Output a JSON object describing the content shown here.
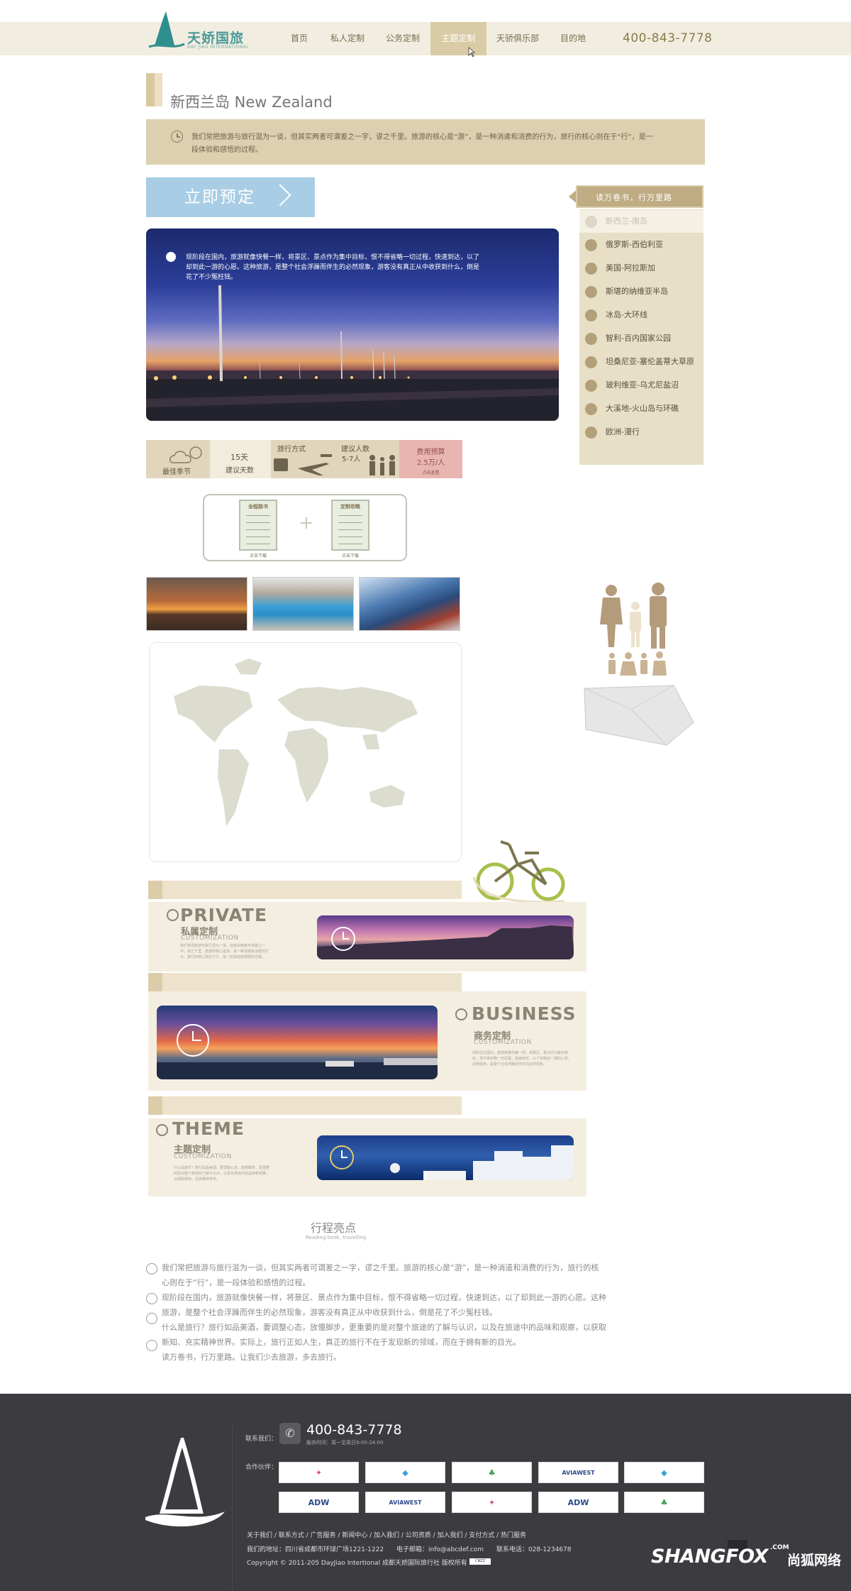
{
  "header": {
    "brand": "天娇国旅",
    "brand_sub": "DAY JIAO INTERNATIONAL",
    "nav": [
      {
        "label": "首页"
      },
      {
        "label": "私人定制"
      },
      {
        "label": "公务定制"
      },
      {
        "label": "主题定制",
        "active": true
      },
      {
        "label": "天骄俱乐部"
      },
      {
        "label": "目的地"
      }
    ],
    "phone": "400-843-7778"
  },
  "page": {
    "title": "新西兰岛 New Zealand",
    "intro": "我们常把旅游与旅行混为一谈，但其实两者可谓差之一字，谬之千里。旅游的核心是“游”，是一种消遣和消费的行为，旅行的核心则在于“行”，是一段体验和感悟的过程。",
    "book_button": "立即预定",
    "hero_text": "现阶段在国内，旅游就像快餐一样，将景区、景点作为集中目标，恨不得省略一切过程，快速到达，以了却到此一游的心愿。这种旅游，是整个社会浮躁而伴生的必然现象，游客没有真正从中收获到什么，倒是花了不少冤枉钱。"
  },
  "info_strip": {
    "season_label": "最佳季节",
    "days_value": "15天",
    "days_label": "建议天数",
    "travel_label": "旅行方式",
    "people_label": "建议人数",
    "people_value": "5-7人",
    "budget_label": "费用预算",
    "budget_value": "2.5万/人",
    "budget_note": "点击查看"
  },
  "docs": [
    {
      "title": "全程路书",
      "download": "点击下载"
    },
    {
      "title": "定制攻略",
      "download": "点击下载"
    }
  ],
  "sidebar": {
    "heading": "读万卷书，行万里路",
    "items": [
      {
        "label": "新西兰-南岛",
        "selected": true
      },
      {
        "label": "俄罗斯-西伯利亚"
      },
      {
        "label": "美国-阿拉斯加"
      },
      {
        "label": "斯堪的纳维亚半岛"
      },
      {
        "label": "冰岛-大环线"
      },
      {
        "label": "智利-百内国家公园"
      },
      {
        "label": "坦桑尼亚-塞伦盖蒂大草原"
      },
      {
        "label": "玻利维亚-乌尤尼盐沼"
      },
      {
        "label": "大溪地-火山岛与环礁"
      },
      {
        "label": "欧洲-漫行"
      }
    ]
  },
  "sections": {
    "private": {
      "head": "PRIVATE",
      "cn": "私属定制",
      "en": "CUSTOMIZATION",
      "desc": "我们常把旅游与旅行混为一谈，但其实两者可谓差之一字，谬之千里。旅游的核心是游，是一种消遣和消费的行为，旅行的核心则在于行，是一段体验和感悟的过程。"
    },
    "business": {
      "head": "BUSINESS",
      "cn": "商务定制",
      "en": "CUSTOMIZATION",
      "desc": "现阶段在国内，旅游就像快餐一样，将景区、景点作为集中目标，恨不得省略一切过程，快速到达，以了却到此一游的心愿。这种旅游，是整个社会浮躁而伴生的必然现象。"
    },
    "theme": {
      "head": "THEME",
      "cn": "主题定制",
      "en": "CUSTOMIZATION",
      "desc": "什么是旅行？旅行如品美酒，要调整心态，放慢脚步，更重要的是对整个旅途的了解与认识，以及在旅途中的品味和观察，以获取新知、充实精神世界。"
    }
  },
  "highlights": {
    "title": "行程亮点",
    "subtitle": "Reading book, travelling",
    "lines": [
      "我们常把旅游与旅行混为一谈，但其实两者可谓差之一字，谬之千里。旅游的核心是“游”，是一种消遣和消费的行为，旅行的核",
      "心则在于“行”，是一段体验和感悟的过程。",
      "现阶段在国内，旅游就像快餐一样，将景区、景点作为集中目标，恨不得省略一切过程，快速到达，以了却到此一游的心愿。这种",
      "旅游，是整个社会浮躁而伴生的必然现象，游客没有真正从中收获到什么，倒是花了不少冤枉钱。",
      "什么是旅行？旅行如品美酒，要调整心态，放慢脚步，更重要的是对整个旅途的了解与认识，以及在旅途中的品味和观察，以获取",
      "新知、充实精神世界。实际上，旅行正如人生，真正的旅行不在于发现新的领域，而在于拥有新的目光。",
      "读万卷书，行万里路。让我们少去旅游，多去旅行。"
    ]
  },
  "footer": {
    "contact_label": "联系我们：",
    "phone": "400-843-7778",
    "hours": "服务时间：周一至周日9:00-24:00",
    "partners_label": "合作伙伴：",
    "partners": [
      "",
      "",
      "",
      "AVIAWEST",
      "",
      "ADW",
      "AVIAWEST",
      "",
      "ADW",
      ""
    ],
    "links": "关于我们 / 联系方式 / 广告服务 / 新闻中心 / 加入我们 / 公司资质 / 加入我们 / 支付方式 / 热门服务",
    "address": "我们的地址：四川省成都市环球广场1221-1222　　电子邮箱：info@abcdef.com　　联系电话：028-1234678",
    "copyright": "Copyright © 2011-205 DayJiao Intertional 成都天娇国际旅行社 版权所有",
    "watermark": "SHANGFOX",
    "watermark_com": ".COM",
    "watermark_cn": "尚狐网络"
  },
  "colors": {
    "accent": "#d8cba5",
    "header_bg": "#f1ede0",
    "book_btn": "#a8cde5",
    "footer_bg": "#3c3c40"
  }
}
